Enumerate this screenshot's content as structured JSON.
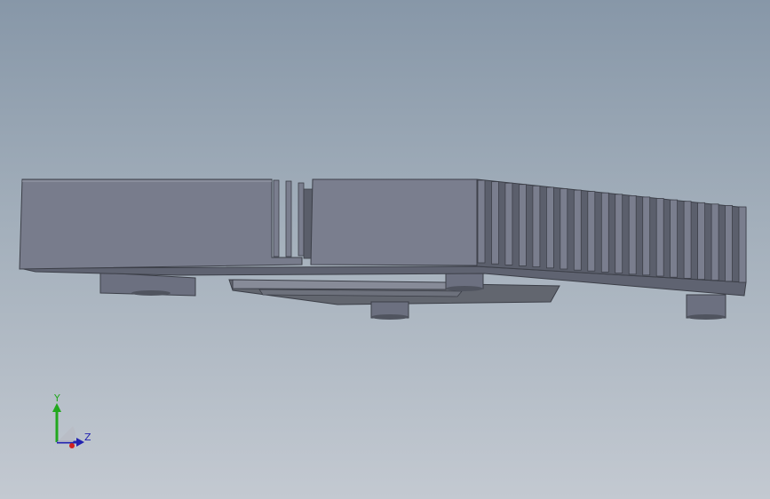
{
  "viewport": {
    "background_top": "#8797a8",
    "background_bottom": "#c3c9d1"
  },
  "model": {
    "body_color": "#6f7382",
    "body_front_color": "#787c8c",
    "body_bottom_color": "#5f6371",
    "fin_color": "#7a7e8e",
    "foot_color": "#6c7080"
  },
  "triad": {
    "axis_y": {
      "label": "Y",
      "color": "#22a81e"
    },
    "axis_z": {
      "label": "Z",
      "color": "#2222b0"
    },
    "axis_x": {
      "color": "#d02020"
    }
  }
}
